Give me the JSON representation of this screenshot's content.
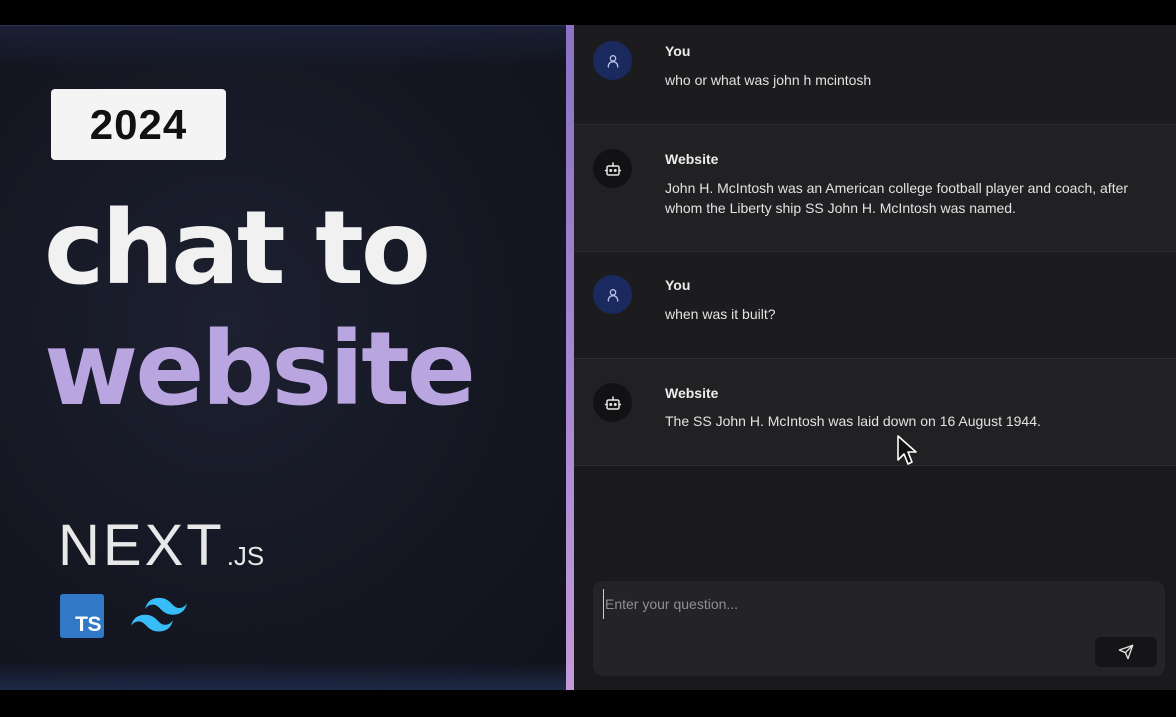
{
  "promo": {
    "year_badge": "2024",
    "headline_line1": "chat to",
    "headline_line2": "website",
    "next_logo_word": "NEXT",
    "next_logo_suffix": ".JS",
    "ts_icon_label": "TS",
    "icons": [
      "nextjs-logo",
      "typescript-icon",
      "tailwind-icon"
    ],
    "colors": {
      "headline_primary": "#f1f1f1",
      "headline_accent": "#b9a6e0",
      "typescript_blue": "#3178c6",
      "tailwind_cyan": "#38bdf8"
    }
  },
  "chat": {
    "messages": [
      {
        "role": "user",
        "author": "You",
        "text": "who or what was john h mcintosh",
        "icon": "user-icon"
      },
      {
        "role": "bot",
        "author": "Website",
        "text": "John H. McIntosh was an American college football player and coach, after whom the Liberty ship SS John H. McIntosh was named.",
        "icon": "bot-icon"
      },
      {
        "role": "user",
        "author": "You",
        "text": "when was it built?",
        "icon": "user-icon"
      },
      {
        "role": "bot",
        "author": "Website",
        "text": "The SS John H. McIntosh was laid down on 16 August 1944.",
        "icon": "bot-icon"
      }
    ],
    "composer": {
      "placeholder": "Enter your question...",
      "value": "",
      "send_icon": "send-icon"
    },
    "colors": {
      "user_avatar_bg": "#1b2a5e",
      "divider_accent": "#a586d2"
    }
  }
}
